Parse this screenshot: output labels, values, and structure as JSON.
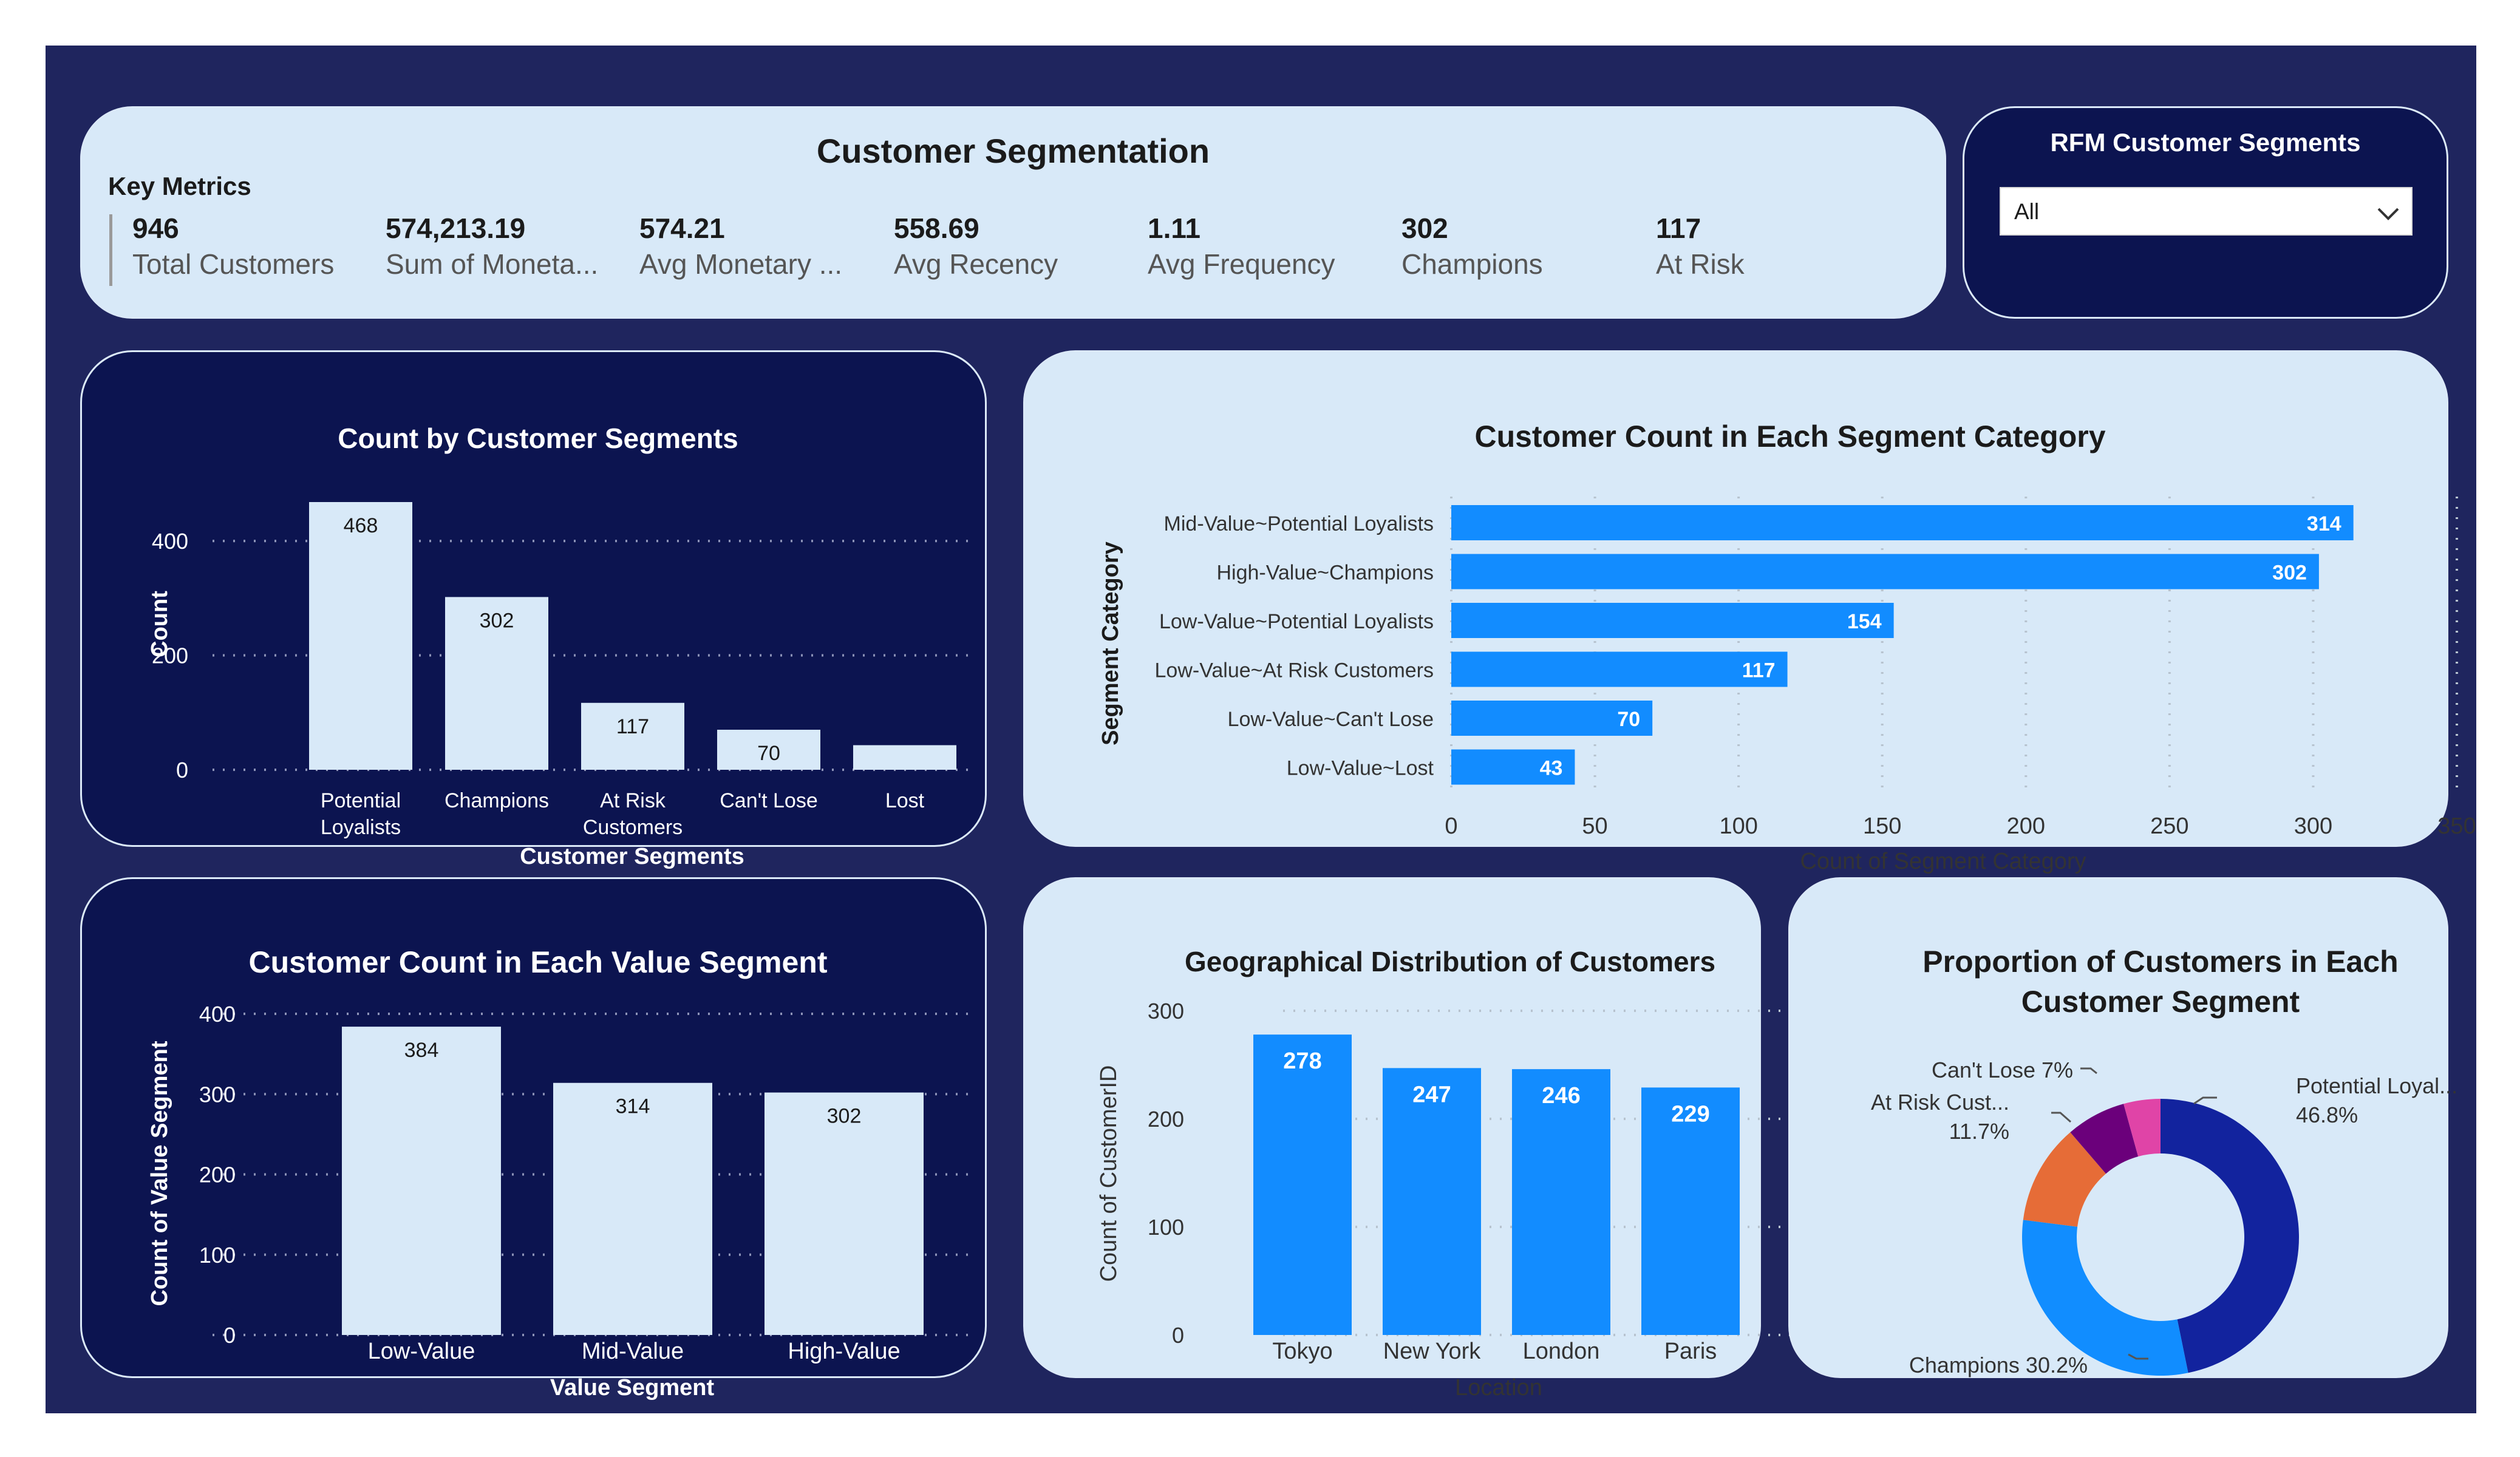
{
  "header": {
    "title": "Customer Segmentation",
    "key_metrics_label": "Key Metrics",
    "metrics": [
      {
        "value": "946",
        "label": "Total Customers"
      },
      {
        "value": "574,213.19",
        "label": "Sum of Moneta..."
      },
      {
        "value": "574.21",
        "label": "Avg Monetary ..."
      },
      {
        "value": "558.69",
        "label": "Avg Recency"
      },
      {
        "value": "1.11",
        "label": "Avg Frequency"
      },
      {
        "value": "302",
        "label": "Champions"
      },
      {
        "value": "117",
        "label": "At Risk"
      }
    ]
  },
  "filter": {
    "title": "RFM Customer Segments",
    "selected": "All",
    "icon": "chevron-down-icon"
  },
  "colors": {
    "background": "#1f255e",
    "dark_panel": "#0c1450",
    "light_panel": "#d8e9f8",
    "bar_light": "#d8e9f8",
    "bar_blue": "#128cff",
    "pie_potential_loyalists": "#12239e",
    "pie_champions": "#118dff",
    "pie_at_risk": "#e66c37",
    "pie_cant_lose": "#6b007b",
    "pie_lost": "#e044a7"
  },
  "chart_data": [
    {
      "type": "bar",
      "title": "Count by Customer Segments",
      "xlabel": "Customer Segments",
      "ylabel": "Count",
      "categories": [
        [
          "Potential",
          "Loyalists"
        ],
        [
          "Champions"
        ],
        [
          "At Risk",
          "Customers"
        ],
        [
          "Can't Lose"
        ],
        [
          "Lost"
        ]
      ],
      "values": [
        468,
        302,
        117,
        70,
        43
      ],
      "data_labels": [
        "468",
        "302",
        "117",
        "70",
        ""
      ],
      "ylim": [
        0,
        468
      ],
      "yticks": [
        0,
        200,
        400
      ],
      "grid": true
    },
    {
      "type": "bar",
      "orientation": "horizontal",
      "title": "Customer Count in Each Segment Category",
      "xlabel": "Count of Segment Category",
      "ylabel": "Segment Category",
      "categories": [
        "Mid-Value~Potential Loyalists",
        "High-Value~Champions",
        "Low-Value~Potential Loyalists",
        "Low-Value~At Risk Customers",
        "Low-Value~Can't Lose",
        "Low-Value~Lost"
      ],
      "values": [
        314,
        302,
        154,
        117,
        70,
        43
      ],
      "xlim": [
        0,
        350
      ],
      "xticks": [
        0,
        50,
        100,
        150,
        200,
        250,
        300,
        350
      ],
      "grid": true
    },
    {
      "type": "bar",
      "title": "Customer Count in Each Value Segment",
      "xlabel": "Value Segment",
      "ylabel": "Count of Value Segment",
      "categories": [
        "Low-Value",
        "Mid-Value",
        "High-Value"
      ],
      "values": [
        384,
        314,
        302
      ],
      "ylim": [
        0,
        400
      ],
      "yticks": [
        0,
        100,
        200,
        300,
        400
      ],
      "grid": true
    },
    {
      "type": "bar",
      "title": "Geographical Distribution of Customers",
      "xlabel": "Location",
      "ylabel": "Count of CustomerID",
      "categories": [
        "Tokyo",
        "New York",
        "London",
        "Paris"
      ],
      "values": [
        278,
        247,
        246,
        229
      ],
      "ylim": [
        0,
        300
      ],
      "yticks": [
        0,
        100,
        200,
        300
      ],
      "grid": true
    },
    {
      "type": "pie",
      "donut": true,
      "title": [
        "Proportion of Customers in Each",
        "Customer Segment"
      ],
      "slices": [
        {
          "name": "Potential Loyalists",
          "value": 46.8,
          "label": [
            "Potential Loyal...",
            "46.8%"
          ],
          "color": "#12239e"
        },
        {
          "name": "Champions",
          "value": 30.2,
          "label": [
            "Champions 30.2%"
          ],
          "color": "#118dff"
        },
        {
          "name": "At Risk Customers",
          "value": 11.7,
          "label": [
            "At Risk Cust...",
            "11.7%"
          ],
          "color": "#e66c37"
        },
        {
          "name": "Can't Lose",
          "value": 7.0,
          "label": [
            "Can't Lose 7%"
          ],
          "color": "#6b007b"
        },
        {
          "name": "Lost",
          "value": 4.3,
          "label": [],
          "color": "#e044a7"
        }
      ]
    }
  ]
}
